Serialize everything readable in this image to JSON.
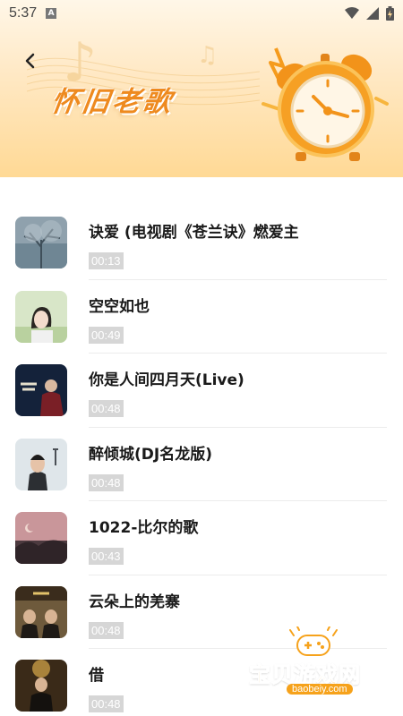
{
  "status_bar": {
    "time": "5:37",
    "notification_icon": "a-notification-icon",
    "icons": [
      "wifi-icon",
      "signal-icon",
      "battery-icon"
    ]
  },
  "header": {
    "title": "怀旧老歌",
    "back_icon": "back-chevron-icon",
    "illustration": "alarm-clock-illustration",
    "colors": {
      "title": "#ee8a1f",
      "background_top": "#fff7e8",
      "background_bottom": "#ffd995"
    }
  },
  "songs": [
    {
      "title": "诀爱 (电视剧《苍兰诀》燃爱主",
      "duration": "00:13",
      "cover": "misty-tree-cover"
    },
    {
      "title": "空空如也",
      "duration": "00:49",
      "cover": "girl-portrait-cover"
    },
    {
      "title": "你是人间四月天(Live)",
      "duration": "00:48",
      "cover": "singer-dark-cover"
    },
    {
      "title": "醉倾城(DJ名龙版)",
      "duration": "00:48",
      "cover": "man-portrait-cover"
    },
    {
      "title": "1022-比尔的歌",
      "duration": "00:43",
      "cover": "pink-sky-cover"
    },
    {
      "title": "云朵上的羌寨",
      "duration": "00:48",
      "cover": "group-cover"
    },
    {
      "title": "借",
      "duration": "00:48",
      "cover": "stage-cover"
    }
  ],
  "watermark": {
    "text": "宝贝游戏网",
    "url": "baobeiy.com",
    "icon": "gamepad-icon"
  }
}
